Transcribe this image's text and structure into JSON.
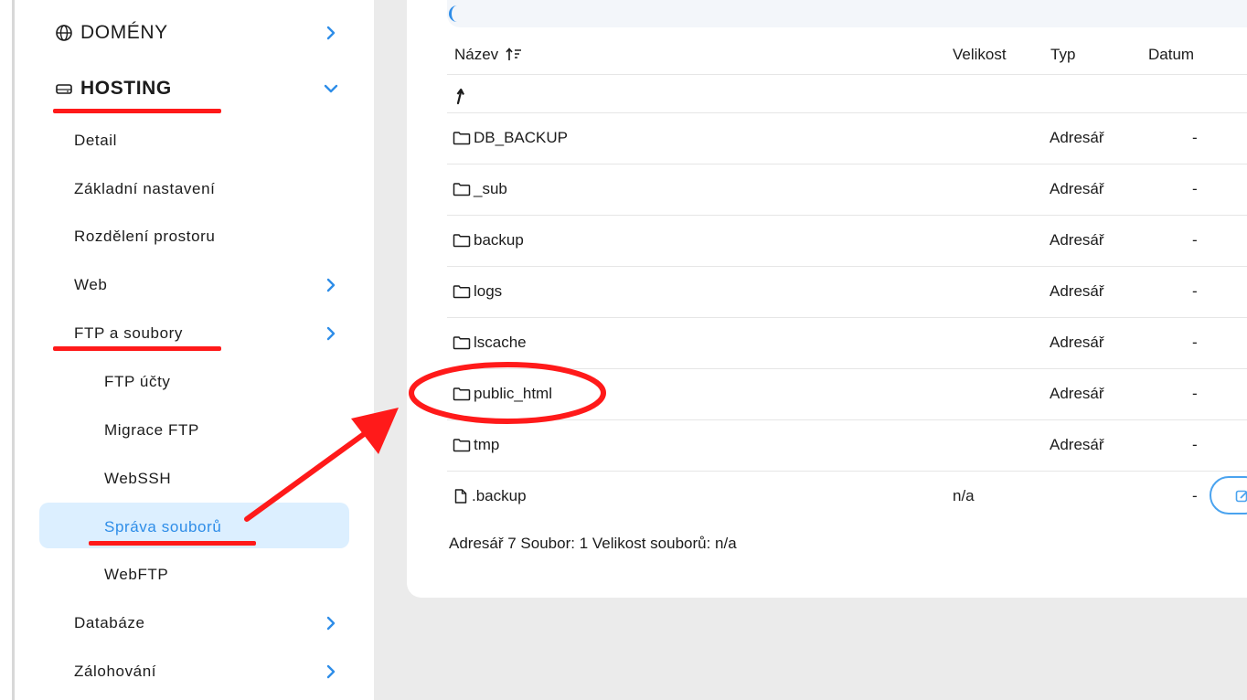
{
  "sidebar": {
    "domains": "DOMÉNY",
    "hosting": "HOSTING",
    "items": {
      "detail": "Detail",
      "basic_settings": "Základní nastavení",
      "space_allocation": "Rozdělení prostoru",
      "web": "Web",
      "ftp_files": "FTP a soubory",
      "ftp_accounts": "FTP účty",
      "ftp_migration": "Migrace FTP",
      "webssh": "WebSSH",
      "file_manager": "Správa souborů",
      "webftp": "WebFTP",
      "databases": "Databáze",
      "backups": "Zálohování"
    }
  },
  "table": {
    "columns": {
      "name": "Název",
      "size": "Velikost",
      "type": "Typ",
      "date": "Datum"
    },
    "rows": [
      {
        "name": "DB_BACKUP",
        "size": "",
        "type": "Adresář",
        "date": "-",
        "kind": "folder"
      },
      {
        "name": "_sub",
        "size": "",
        "type": "Adresář",
        "date": "-",
        "kind": "folder"
      },
      {
        "name": "backup",
        "size": "",
        "type": "Adresář",
        "date": "-",
        "kind": "folder"
      },
      {
        "name": "logs",
        "size": "",
        "type": "Adresář",
        "date": "-",
        "kind": "folder"
      },
      {
        "name": "lscache",
        "size": "",
        "type": "Adresář",
        "date": "-",
        "kind": "folder"
      },
      {
        "name": "public_html",
        "size": "",
        "type": "Adresář",
        "date": "-",
        "kind": "folder"
      },
      {
        "name": "tmp",
        "size": "",
        "type": "Adresář",
        "date": "-",
        "kind": "folder"
      },
      {
        "name": ".backup",
        "size": "n/a",
        "type": "",
        "date": "-",
        "kind": "file"
      }
    ],
    "summary": "Adresář 7 Soubor: 1 Velikost souborů: n/a"
  },
  "colors": {
    "accent": "#2e8de8",
    "active_bg": "#dcefff",
    "annotation_red": "#ff1a1a"
  }
}
